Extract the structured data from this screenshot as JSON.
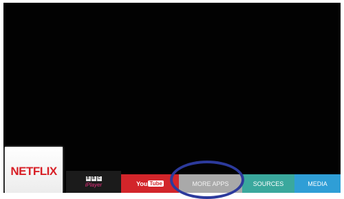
{
  "tiles": {
    "netflix": "NETFLIX",
    "iplayer_logo": [
      "B",
      "B",
      "C"
    ],
    "iplayer_label": "iPlayer",
    "youtube_you": "You",
    "youtube_tube": "Tube",
    "more_apps": "MORE APPS",
    "sources": "SOURCES",
    "media": "MEDIA"
  },
  "colors": {
    "netflix_red": "#d81f26",
    "youtube_red": "#d2252a",
    "more_apps_gray": "#a9a9a9",
    "sources_teal": "#3aa89d",
    "media_blue": "#2f9ed6",
    "highlight_ring": "#2c3a9c"
  }
}
